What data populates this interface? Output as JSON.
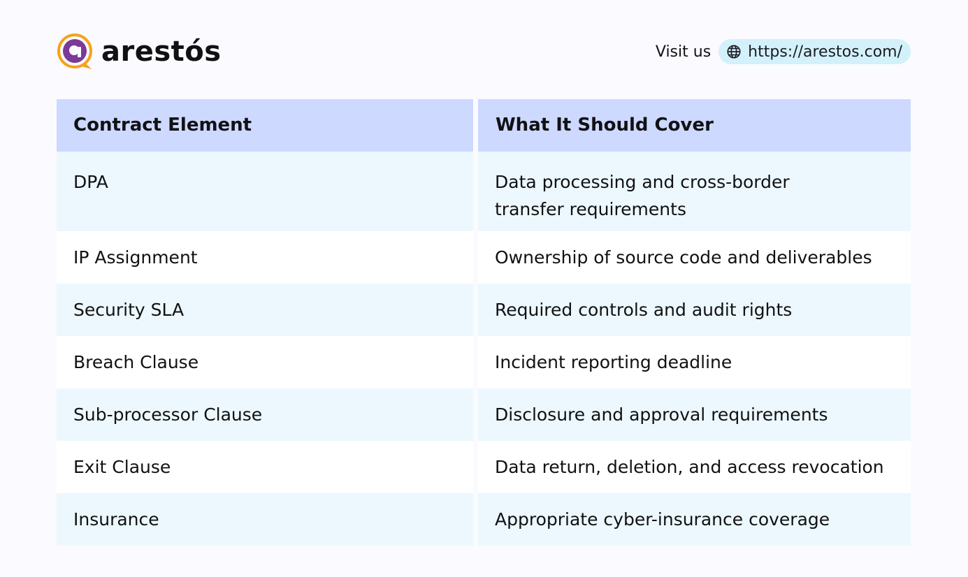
{
  "brand": {
    "name": "arestós",
    "colors": {
      "orange": "#f5a31a",
      "purple": "#7a3a96"
    }
  },
  "header": {
    "visit_label": "Visit us",
    "link_text": "https://arestos.com/",
    "link_icon": "globe-icon"
  },
  "table": {
    "headers": [
      "Contract Element",
      "What It Should Cover"
    ],
    "rows": [
      {
        "element": "DPA",
        "cover": "Data processing and cross-border transfer requirements"
      },
      {
        "element": "IP Assignment",
        "cover": "Ownership of source code and deliverables"
      },
      {
        "element": "Security SLA",
        "cover": "Required controls and audit rights"
      },
      {
        "element": "Breach Clause",
        "cover": "Incident reporting deadline"
      },
      {
        "element": "Sub-processor Clause",
        "cover": "Disclosure and approval requirements"
      },
      {
        "element": "Exit Clause",
        "cover": "Data return, deletion, and access revocation"
      },
      {
        "element": "Insurance",
        "cover": "Appropriate cyber-insurance coverage"
      }
    ],
    "colors": {
      "header_bg": "#cdd9ff",
      "row_alt_bg": "#ecf8fd",
      "row_bg": "#ffffff"
    }
  }
}
